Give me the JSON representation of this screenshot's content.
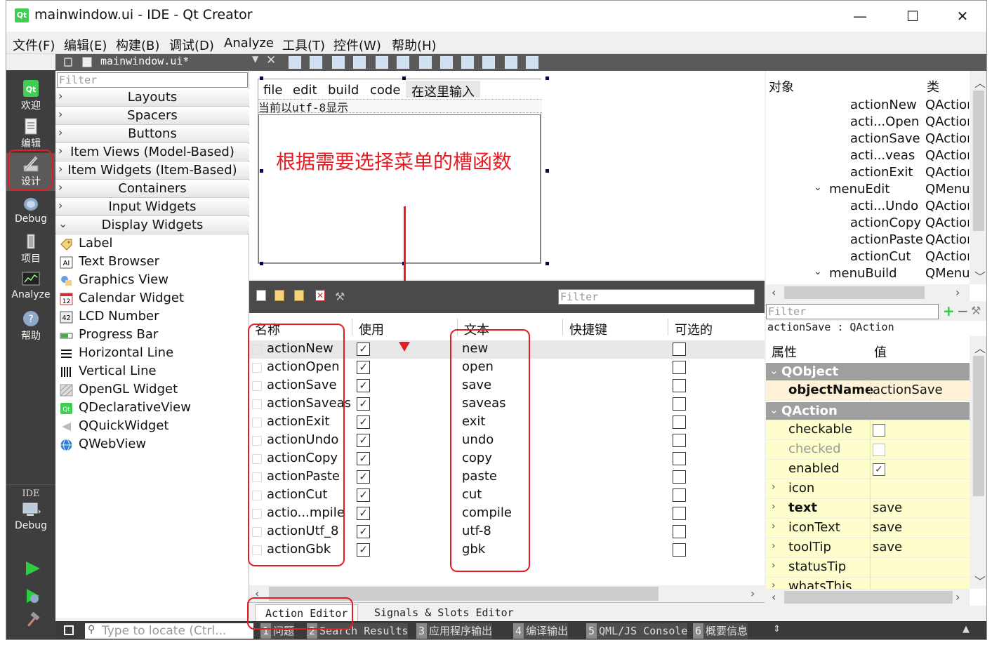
{
  "window": {
    "title": "mainwindow.ui - IDE - Qt Creator",
    "logo": "Qt",
    "controls": [
      "—",
      "☐",
      "✕"
    ]
  },
  "menubar": [
    "文件(F)",
    "编辑(E)",
    "构建(B)",
    "调试(D)",
    "Analyze",
    "工具(T)",
    "控件(W)",
    "帮助(H)"
  ],
  "modes": [
    {
      "label": "欢迎",
      "icon": "qt-logo-icon"
    },
    {
      "label": "编辑",
      "icon": "edit-document-icon"
    },
    {
      "label": "设计",
      "icon": "design-pencil-icon"
    },
    {
      "label": "Debug",
      "icon": "debug-bug-icon"
    },
    {
      "label": "项目",
      "icon": "project-wrench-icon"
    },
    {
      "label": "Analyze",
      "icon": "analyze-monitor-icon"
    },
    {
      "label": "帮助",
      "icon": "help-question-icon"
    }
  ],
  "kit": {
    "title": "IDE",
    "config": "Debug"
  },
  "document": {
    "name": "mainwindow.ui*"
  },
  "widget_box": {
    "filter_placeholder": "Filter",
    "categories": [
      "Layouts",
      "Spacers",
      "Buttons",
      "Item Views (Model-Based)",
      "Item Widgets (Item-Based)",
      "Containers",
      "Input Widgets",
      "Display Widgets"
    ],
    "display_widgets": [
      "Label",
      "Text Browser",
      "Graphics View",
      "Calendar Widget",
      "LCD Number",
      "Progress Bar",
      "Horizontal Line",
      "Vertical Line",
      "OpenGL Widget",
      "QDeclarativeView",
      "QQuickWidget",
      "QWebView"
    ]
  },
  "form": {
    "menus": [
      "file",
      "edit",
      "build",
      "code"
    ],
    "type_here": "在这里输入",
    "toolbar_text": "当前以utf-8显示",
    "annotation": "根据需要选择菜单的槽函数"
  },
  "action_editor": {
    "filter_placeholder": "Filter",
    "headers": [
      "名称",
      "使用",
      "文本",
      "快捷键",
      "可选的"
    ],
    "rows": [
      {
        "name": "actionNew",
        "used": true,
        "text": "new",
        "checkable": false
      },
      {
        "name": "actionOpen",
        "used": true,
        "text": "open",
        "checkable": false
      },
      {
        "name": "actionSave",
        "used": true,
        "text": "save",
        "checkable": false
      },
      {
        "name": "actionSaveas",
        "used": true,
        "text": "saveas",
        "checkable": false
      },
      {
        "name": "actionExit",
        "used": true,
        "text": "exit",
        "checkable": false
      },
      {
        "name": "actionUndo",
        "used": true,
        "text": "undo",
        "checkable": false
      },
      {
        "name": "actionCopy",
        "used": true,
        "text": "copy",
        "checkable": false
      },
      {
        "name": "actionPaste",
        "used": true,
        "text": "paste",
        "checkable": false
      },
      {
        "name": "actionCut",
        "used": true,
        "text": "cut",
        "checkable": false
      },
      {
        "name": "actio...mpile",
        "used": true,
        "text": "compile",
        "checkable": false
      },
      {
        "name": "actionUtf_8",
        "used": true,
        "text": "utf-8",
        "checkable": false
      },
      {
        "name": "actionGbk",
        "used": true,
        "text": "gbk",
        "checkable": false
      }
    ],
    "tabs": [
      "Action Editor",
      "Signals & Slots Editor"
    ]
  },
  "object_inspector": {
    "headers": [
      "对象",
      "类"
    ],
    "rows": [
      {
        "name": "actionNew",
        "cls": "QAction",
        "indent": 2
      },
      {
        "name": "acti...Open",
        "cls": "QAction",
        "indent": 2
      },
      {
        "name": "actionSave",
        "cls": "QAction",
        "indent": 2
      },
      {
        "name": "acti...veas",
        "cls": "QAction",
        "indent": 2
      },
      {
        "name": "actionExit",
        "cls": "QAction",
        "indent": 2
      },
      {
        "name": "menuEdit",
        "cls": "QMenu",
        "indent": 1,
        "expander": "⌄"
      },
      {
        "name": "acti...Undo",
        "cls": "QAction",
        "indent": 2
      },
      {
        "name": "actionCopy",
        "cls": "QAction",
        "indent": 2
      },
      {
        "name": "actionPaste",
        "cls": "QAction",
        "indent": 2
      },
      {
        "name": "actionCut",
        "cls": "QAction",
        "indent": 2
      },
      {
        "name": "menuBuild",
        "cls": "QMenu",
        "indent": 1,
        "expander": "⌄"
      }
    ]
  },
  "property_editor": {
    "filter_placeholder": "Filter",
    "object_info": "actionSave : QAction",
    "headers": [
      "属性",
      "值"
    ],
    "group_qobject": "QObject",
    "object_name_label": "objectName",
    "object_name_value": "actionSave",
    "group_qaction": "QAction",
    "props": [
      {
        "name": "checkable",
        "type": "bool",
        "value": false,
        "bold": false,
        "dim": false
      },
      {
        "name": "checked",
        "type": "bool",
        "value": false,
        "bold": false,
        "dim": true
      },
      {
        "name": "enabled",
        "type": "bool",
        "value": true,
        "bold": false,
        "dim": false
      },
      {
        "name": "icon",
        "type": "expand",
        "value": "",
        "bold": false,
        "dim": false
      },
      {
        "name": "text",
        "type": "expand",
        "value": "save",
        "bold": true,
        "dim": false
      },
      {
        "name": "iconText",
        "type": "expand",
        "value": "save",
        "bold": false,
        "dim": false
      },
      {
        "name": "toolTip",
        "type": "expand",
        "value": "save",
        "bold": false,
        "dim": false
      },
      {
        "name": "statusTip",
        "type": "expand",
        "value": "",
        "bold": false,
        "dim": false
      },
      {
        "name": "whatsThis",
        "type": "expand",
        "value": "",
        "bold": false,
        "dim": false
      }
    ]
  },
  "statusbar": {
    "locator_placeholder": "Type to locate (Ctrl...",
    "tabs": [
      {
        "n": "1",
        "label": "问题"
      },
      {
        "n": "2",
        "label": "Search Results"
      },
      {
        "n": "3",
        "label": "应用程序输出"
      },
      {
        "n": "4",
        "label": "编译输出"
      },
      {
        "n": "5",
        "label": "QML/JS Console"
      },
      {
        "n": "6",
        "label": "概要信息"
      }
    ]
  },
  "colors": {
    "annotation_red": "#e61b23",
    "dark_bar": "#3e3e3e",
    "group_gray": "#9f9f9f",
    "prop_yellow": "#fefecc"
  }
}
